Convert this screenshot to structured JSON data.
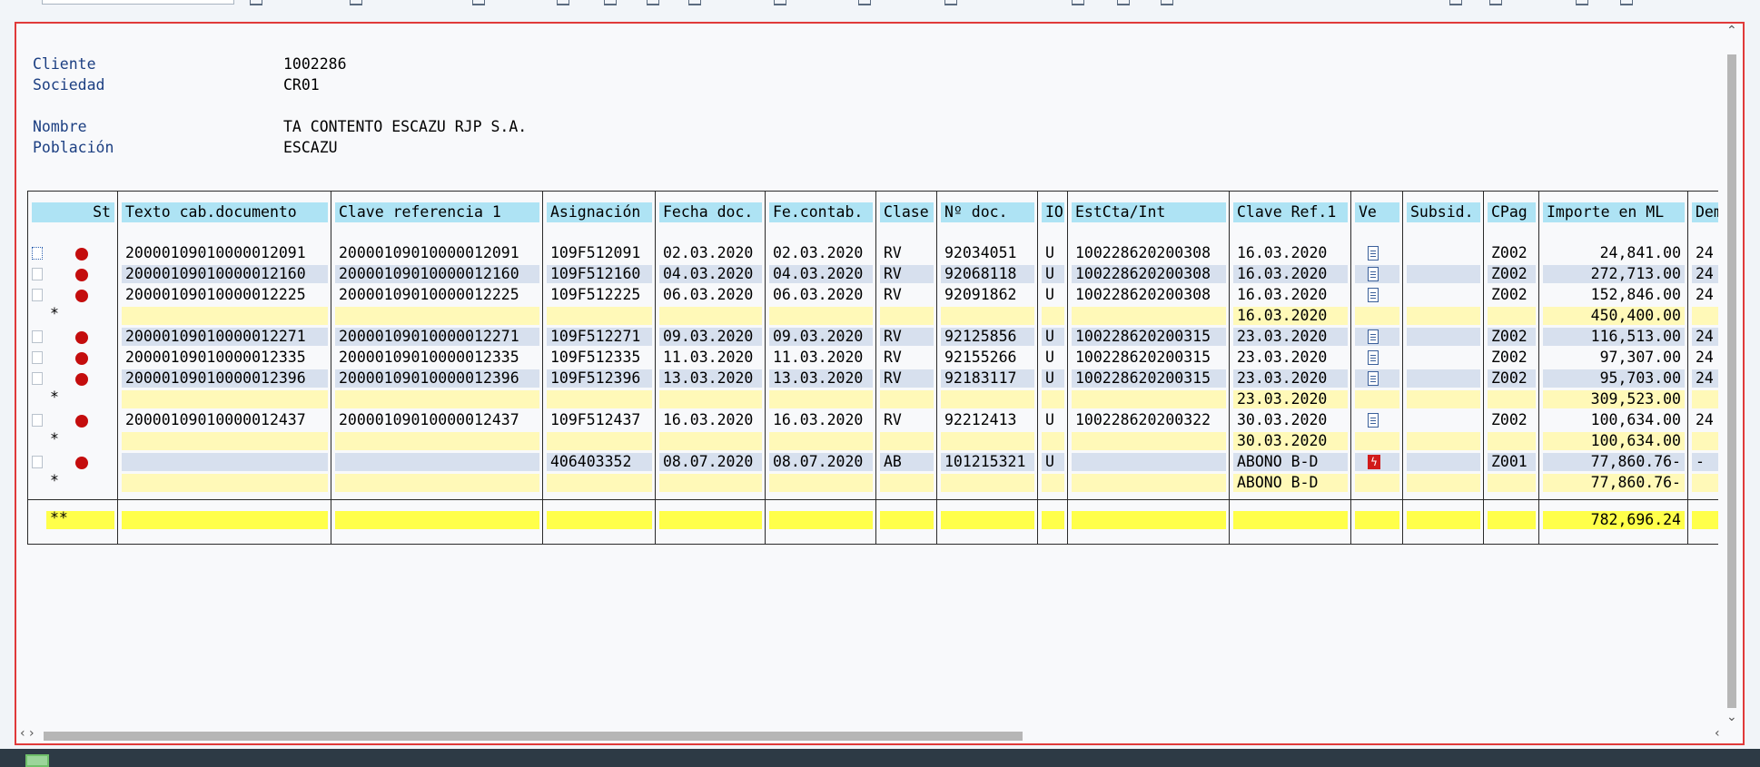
{
  "header": {
    "labels": [
      "Cliente",
      "Sociedad",
      "Nombre",
      "Población"
    ],
    "values": [
      "1002286",
      "CR01",
      "TA CONTENTO ESCAZU RJP S.A.",
      "ESCAZU"
    ]
  },
  "columns": [
    "St",
    "Texto cab.documento",
    "Clave referencia 1",
    "Asignación",
    "Fecha doc.",
    "Fe.contab.",
    "Clase",
    "Nº doc.",
    "IO",
    "EstCta/Int",
    "Clave Ref.1",
    "Ve",
    "Subsid.",
    "CPag",
    "Importe en ML",
    "Demo"
  ],
  "rows": [
    {
      "kind": "item",
      "alt": false,
      "focus": true,
      "icon": "doc",
      "texto": "20000109010000012091",
      "clave": "20000109010000012091",
      "asig": "109F512091",
      "fdoc": "02.03.2020",
      "fcont": "02.03.2020",
      "clase": "RV",
      "ndoc": "92034051",
      "io": "U",
      "estcta": "100228620200308",
      "cref": "16.03.2020",
      "cpag": "Z002",
      "importe": "24,841.00",
      "demo": "24"
    },
    {
      "kind": "item",
      "alt": true,
      "focus": false,
      "icon": "doc",
      "texto": "20000109010000012160",
      "clave": "20000109010000012160",
      "asig": "109F512160",
      "fdoc": "04.03.2020",
      "fcont": "04.03.2020",
      "clase": "RV",
      "ndoc": "92068118",
      "io": "U",
      "estcta": "100228620200308",
      "cref": "16.03.2020",
      "cpag": "Z002",
      "importe": "272,713.00",
      "demo": "24"
    },
    {
      "kind": "item",
      "alt": false,
      "focus": false,
      "icon": "doc",
      "texto": "20000109010000012225",
      "clave": "20000109010000012225",
      "asig": "109F512225",
      "fdoc": "06.03.2020",
      "fcont": "06.03.2020",
      "clase": "RV",
      "ndoc": "92091862",
      "io": "U",
      "estcta": "100228620200308",
      "cref": "16.03.2020",
      "cpag": "Z002",
      "importe": "152,846.00",
      "demo": "24"
    },
    {
      "kind": "sub",
      "mark": "*",
      "cref": "16.03.2020",
      "importe": "450,400.00"
    },
    {
      "kind": "item",
      "alt": true,
      "focus": false,
      "icon": "doc",
      "texto": "20000109010000012271",
      "clave": "20000109010000012271",
      "asig": "109F512271",
      "fdoc": "09.03.2020",
      "fcont": "09.03.2020",
      "clase": "RV",
      "ndoc": "92125856",
      "io": "U",
      "estcta": "100228620200315",
      "cref": "23.03.2020",
      "cpag": "Z002",
      "importe": "116,513.00",
      "demo": "24"
    },
    {
      "kind": "item",
      "alt": false,
      "focus": false,
      "icon": "doc",
      "texto": "20000109010000012335",
      "clave": "20000109010000012335",
      "asig": "109F512335",
      "fdoc": "11.03.2020",
      "fcont": "11.03.2020",
      "clase": "RV",
      "ndoc": "92155266",
      "io": "U",
      "estcta": "100228620200315",
      "cref": "23.03.2020",
      "cpag": "Z002",
      "importe": "97,307.00",
      "demo": "24"
    },
    {
      "kind": "item",
      "alt": true,
      "focus": false,
      "icon": "doc",
      "texto": "20000109010000012396",
      "clave": "20000109010000012396",
      "asig": "109F512396",
      "fdoc": "13.03.2020",
      "fcont": "13.03.2020",
      "clase": "RV",
      "ndoc": "92183117",
      "io": "U",
      "estcta": "100228620200315",
      "cref": "23.03.2020",
      "cpag": "Z002",
      "importe": "95,703.00",
      "demo": "24"
    },
    {
      "kind": "sub",
      "mark": "*",
      "cref": "23.03.2020",
      "importe": "309,523.00"
    },
    {
      "kind": "item",
      "alt": false,
      "focus": false,
      "icon": "doc",
      "texto": "20000109010000012437",
      "clave": "20000109010000012437",
      "asig": "109F512437",
      "fdoc": "16.03.2020",
      "fcont": "16.03.2020",
      "clase": "RV",
      "ndoc": "92212413",
      "io": "U",
      "estcta": "100228620200322",
      "cref": "30.03.2020",
      "cpag": "Z002",
      "importe": "100,634.00",
      "demo": "24"
    },
    {
      "kind": "sub",
      "mark": "*",
      "cref": "30.03.2020",
      "importe": "100,634.00"
    },
    {
      "kind": "item",
      "alt": true,
      "focus": false,
      "icon": "flash",
      "texto": "",
      "clave": "",
      "asig": "406403352",
      "fdoc": "08.07.2020",
      "fcont": "08.07.2020",
      "clase": "AB",
      "ndoc": "101215321",
      "io": "U",
      "estcta": "",
      "cref": "ABONO B-D",
      "cpag": "Z001",
      "importe": "77,860.76-",
      "demo": "-"
    },
    {
      "kind": "sub",
      "mark": "*",
      "cref": "ABONO B-D",
      "importe": "77,860.76-"
    }
  ],
  "total": {
    "mark": "**",
    "importe": "782,696.24"
  },
  "icons": {
    "status": "red-dot-icon",
    "doc": "document-list-icon",
    "flash": "lightning-icon"
  }
}
